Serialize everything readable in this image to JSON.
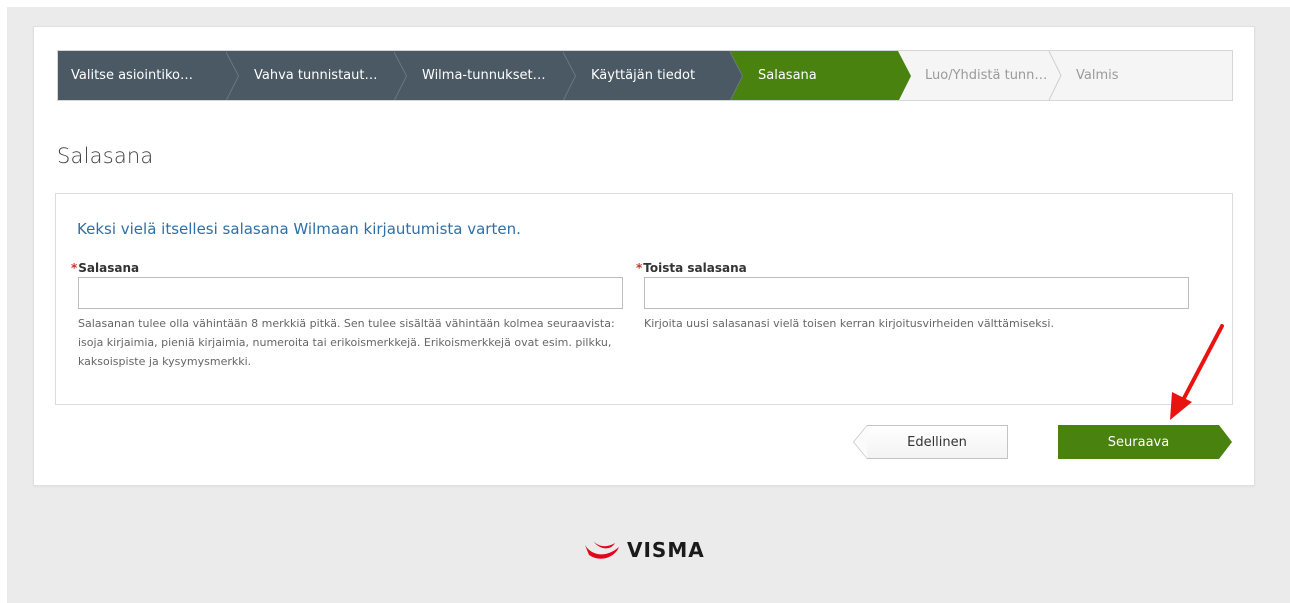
{
  "wizard": {
    "steps": [
      {
        "label": "Valitse asiointiko…",
        "state": "done"
      },
      {
        "label": "Vahva tunnistaut…",
        "state": "done"
      },
      {
        "label": "Wilma-tunnukset…",
        "state": "done"
      },
      {
        "label": "Käyttäjän tiedot",
        "state": "done"
      },
      {
        "label": "Salasana",
        "state": "active"
      },
      {
        "label": "Luo/Yhdistä tunn…",
        "state": "todo"
      },
      {
        "label": "Valmis",
        "state": "todo"
      }
    ]
  },
  "page": {
    "title": "Salasana"
  },
  "form": {
    "intro": "Keksi vielä itsellesi salasana Wilmaan kirjautumista varten.",
    "required_marker": "*",
    "password": {
      "label": "Salasana",
      "value": "",
      "help": "Salasanan tulee olla vähintään 8 merkkiä pitkä. Sen tulee sisältää vähintään kolmea seuraavista: isoja kirjaimia, pieniä kirjaimia, numeroita tai erikoismerkkejä. Erikoismerkkejä ovat esim. pilkku, kaksoispiste ja kysymysmerkki."
    },
    "password_repeat": {
      "label": "Toista salasana",
      "value": "",
      "help": "Kirjoita uusi salasanasi vielä toisen kerran kirjoitusvirheiden välttämiseksi."
    }
  },
  "buttons": {
    "previous": "Edellinen",
    "next": "Seuraava"
  },
  "footer": {
    "logo_text": "VISMA"
  },
  "colors": {
    "step_done": "#4a5963",
    "step_active": "#4a820f",
    "intro_text": "#2e6fa6",
    "annotation_arrow": "#e8140f",
    "logo_mark": "#e3051b"
  }
}
